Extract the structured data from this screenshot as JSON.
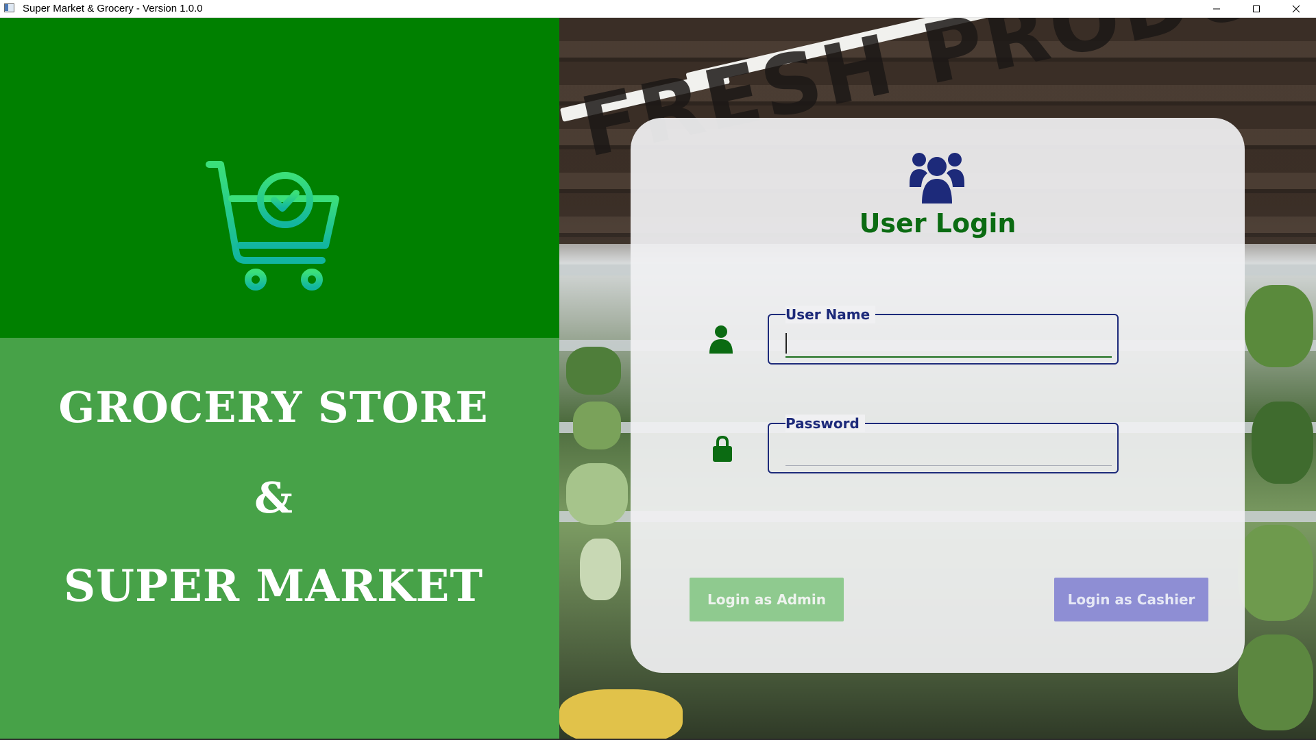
{
  "window": {
    "title": "Super Market & Grocery - Version 1.0.0",
    "controls": [
      "minimize-icon",
      "maximize-icon",
      "close-icon"
    ]
  },
  "brand": {
    "line1": "GROCERY STORE",
    "line2": "&",
    "line3": "SUPER MARKET",
    "logo_icon": "shopping-cart-check-icon"
  },
  "login": {
    "header_icon": "users-group-icon",
    "title": "User Login",
    "username": {
      "label": "User Name",
      "value": "",
      "icon": "user-icon"
    },
    "password": {
      "label": "Password",
      "value": "",
      "icon": "lock-icon"
    },
    "admin_button": "Login as Admin",
    "cashier_button": "Login as Cashier"
  },
  "background": {
    "sign_text": "FRESH PRODUCE"
  },
  "colors": {
    "left_top": "#008000",
    "left_bottom": "#47a248",
    "title_green": "#0b6b12",
    "field_blue": "#1d2a7a",
    "admin_button": "#8fca8f",
    "cashier_button": "#8e8ed4",
    "cart_gradient_top": "#3be07a",
    "cart_gradient_bottom": "#12b5a0"
  }
}
